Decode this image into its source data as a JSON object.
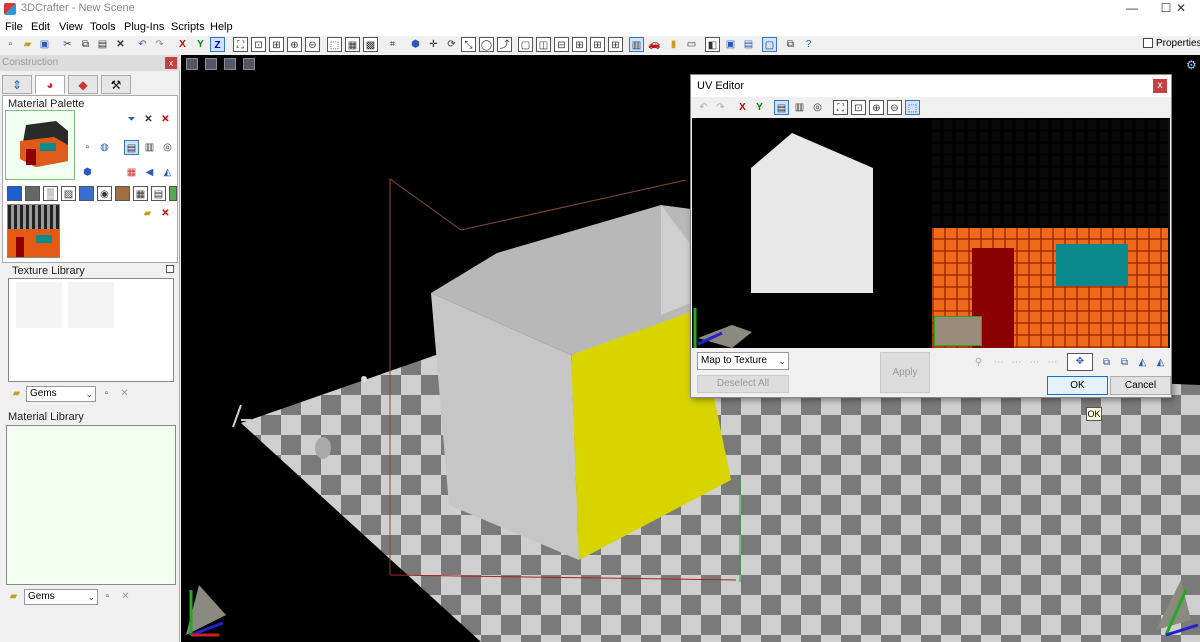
{
  "window": {
    "title": "3DCrafter - New Scene",
    "minimize": "—",
    "maximize": "☐",
    "close": "✕"
  },
  "menu": [
    "File",
    "Edit",
    "View",
    "Tools",
    "Plug-Ins",
    "Scripts",
    "Help"
  ],
  "toolbar": {
    "x_label": "X",
    "y_label": "Y",
    "z_label": "Z",
    "properties_label": "Properties|"
  },
  "construction": {
    "title": "Construction",
    "tabs": [
      "⇕",
      "◕",
      "◆",
      "⚒"
    ],
    "material_palette_label": "Material Palette",
    "texture_library_label": "Texture Library",
    "texture_combo": "Gems",
    "material_library_label": "Material Library",
    "material_combo": "Gems"
  },
  "uv_editor": {
    "title": "UV Editor",
    "x_label": "X",
    "y_label": "Y",
    "mapping_select": "Map to Texture",
    "deselect_all": "Deselect All",
    "apply": "Apply",
    "ok": "OK",
    "cancel": "Cancel"
  },
  "tooltip": "OK",
  "colors": {
    "accent": "#0078d7",
    "house_gray": "#c6c6c6",
    "house_yellow": "#d8d400",
    "brick_orange": "#ef6a1a",
    "window_teal": "#0a8a8a",
    "door_red": "#8b0000"
  }
}
